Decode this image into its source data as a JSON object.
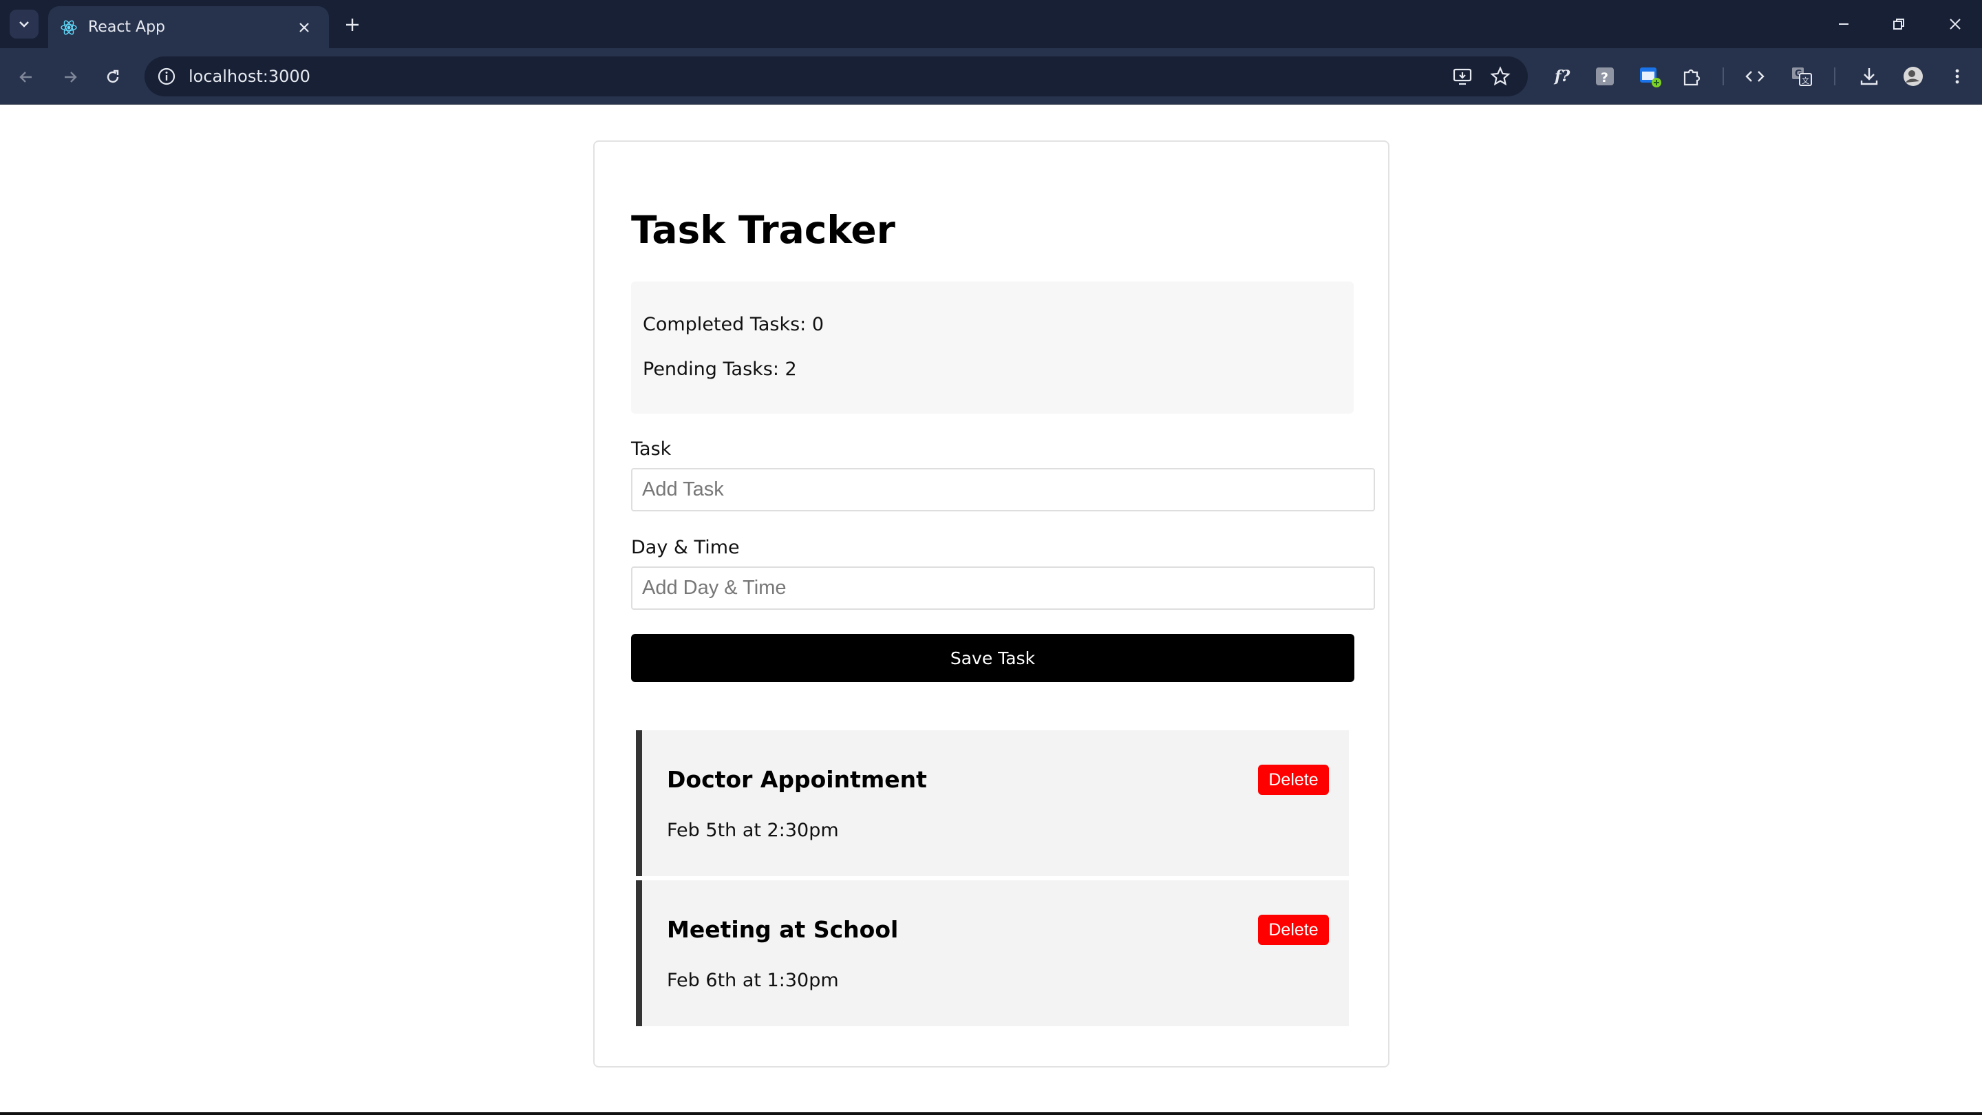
{
  "browser": {
    "tab_title": "React App",
    "url": "localhost:3000"
  },
  "icons": {
    "tab_search": "chevron-down-icon",
    "favicon": "react-icon",
    "tab_close": "close-icon",
    "new_tab": "plus-icon",
    "minimize": "minimize-icon",
    "restore": "restore-icon",
    "close_window": "close-icon",
    "back": "arrow-left-icon",
    "forward": "arrow-right-icon",
    "reload": "reload-icon",
    "site_info": "info-icon",
    "install": "install-icon",
    "bookmark": "star-icon",
    "extensions": [
      "function-icon",
      "help-icon",
      "calendar-icon",
      "puzzle-icon",
      "code-icon",
      "translate-icon",
      "download-icon",
      "profile-icon",
      "menu-icon"
    ]
  },
  "app": {
    "title": "Task Tracker",
    "stats": {
      "completed": "Completed Tasks: 0",
      "pending": "Pending Tasks: 2"
    },
    "form": {
      "task_label": "Task",
      "task_placeholder": "Add Task",
      "day_label": "Day & Time",
      "day_placeholder": "Add Day & Time",
      "save_label": "Save Task"
    },
    "tasks": [
      {
        "title": "Doctor Appointment",
        "date": "Feb 5th at 2:30pm",
        "delete_label": "Delete"
      },
      {
        "title": "Meeting at School",
        "date": "Feb 6th at 1:30pm",
        "delete_label": "Delete"
      }
    ]
  },
  "colors": {
    "chrome_dark": "#172035",
    "chrome_toolbar": "#27324c",
    "save_button": "#000000",
    "delete_button": "#ff0000",
    "task_border": "#333333",
    "task_background": "#f3f3f3"
  }
}
